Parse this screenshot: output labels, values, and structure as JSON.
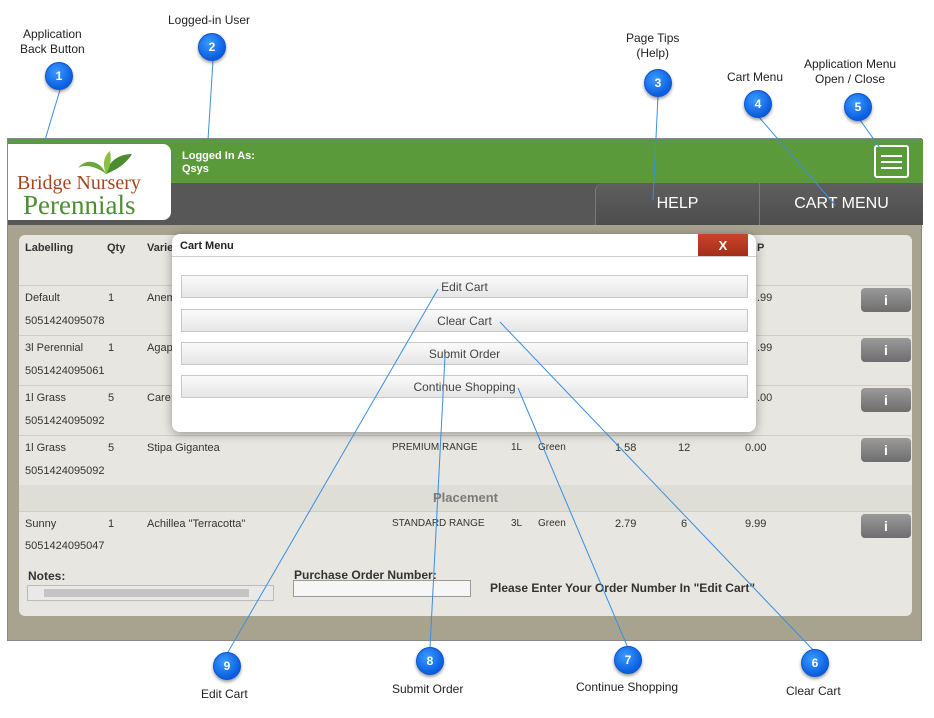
{
  "annotations": [
    {
      "num": "1",
      "label_lines": [
        "Application",
        "Back Button"
      ]
    },
    {
      "num": "2",
      "label_lines": [
        "Logged-in User"
      ]
    },
    {
      "num": "3",
      "label_lines": [
        "Page Tips",
        "(Help)"
      ]
    },
    {
      "num": "4",
      "label_lines": [
        "Cart Menu"
      ]
    },
    {
      "num": "5",
      "label_lines": [
        "Application Menu",
        "Open / Close"
      ]
    },
    {
      "num": "6",
      "label_lines": [
        "Clear Cart"
      ]
    },
    {
      "num": "7",
      "label_lines": [
        "Continue Shopping"
      ]
    },
    {
      "num": "8",
      "label_lines": [
        "Submit Order"
      ]
    },
    {
      "num": "9",
      "label_lines": [
        "Edit Cart"
      ]
    }
  ],
  "logo": {
    "line1": "Bridge Nursery",
    "line2": "Perennials"
  },
  "header": {
    "logged_in_label": "Logged In As:",
    "username": "Qsys"
  },
  "nav": {
    "help": "HELP",
    "cart_menu": "CART MENU"
  },
  "table": {
    "headers": {
      "labelling": "Labelling",
      "qty": "Qty",
      "variety": "Varie",
      "rrp": "P"
    },
    "rows": [
      {
        "labelling": "Default",
        "qty": "1",
        "variety": "Anem",
        "barcode": "5051424095078",
        "price": ".99",
        "info": "i"
      },
      {
        "labelling": "3l Perennial",
        "qty": "1",
        "variety": "Agap",
        "barcode": "5051424095061",
        "price": ".99",
        "info": "i"
      },
      {
        "labelling": "1l Grass",
        "qty": "5",
        "variety": "Care:",
        "barcode": "5051424095092",
        "price": ".00",
        "info": "i"
      },
      {
        "labelling": "1l Grass",
        "qty": "5",
        "variety": "Stipa Gigantea",
        "barcode": "5051424095092",
        "range": "PREMIUM RANGE",
        "size": "1L",
        "color": "Green",
        "cost": "1.58",
        "pack": "12",
        "price": "0.00",
        "info": "i"
      }
    ],
    "section": "Placement",
    "placement_row": {
      "labelling": "Sunny",
      "qty": "1",
      "variety": "Achillea \"Terracotta\"",
      "barcode": "5051424095047",
      "range": "STANDARD RANGE",
      "size": "3L",
      "color": "Green",
      "cost": "2.79",
      "pack": "6",
      "price": "9.99",
      "info": "i"
    }
  },
  "footer": {
    "notes_label": "Notes:",
    "po_label": "Purchase Order Number:",
    "po_hint": "Please Enter Your Order Number In \"Edit Cart\""
  },
  "modal": {
    "title": "Cart Menu",
    "close": "X",
    "buttons": [
      "Edit Cart",
      "Clear Cart",
      "Submit Order",
      "Continue Shopping"
    ]
  }
}
